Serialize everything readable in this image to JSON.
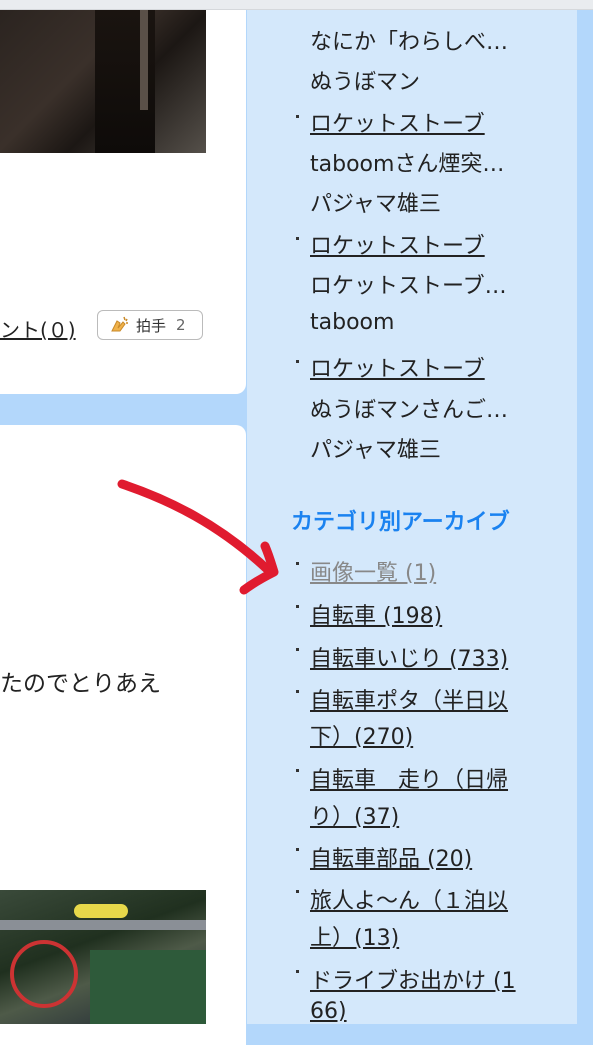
{
  "left": {
    "comment_link": "ント(０)",
    "clap_label": "拍手",
    "clap_count": "2",
    "body_text": "たのでとりあえ"
  },
  "sidebar": {
    "comments": [
      {
        "article": "",
        "text": "なにか「わらしべ…",
        "author": "ぬうぼマン"
      },
      {
        "article": "ロケットストーブ",
        "text": "taboomさん煙突…",
        "author": "パジャマ雄三"
      },
      {
        "article": "ロケットストーブ",
        "text": "ロケットストーブ…",
        "author": "taboom"
      },
      {
        "article": "ロケットストーブ",
        "text": "ぬうぼマンさんご…",
        "author": "パジャマ雄三"
      }
    ],
    "category_title": "カテゴリ別アーカイブ",
    "categories": [
      {
        "line1": "画像一覧 (1)",
        "line2": ""
      },
      {
        "line1": "自転車 (198)",
        "line2": ""
      },
      {
        "line1": "自転車いじり (733)",
        "line2": ""
      },
      {
        "line1": "自転車ポタ（半日以",
        "line2": "下）(270)"
      },
      {
        "line1": "自転車　走り（日帰",
        "line2": "り）(37)"
      },
      {
        "line1": "自転車部品 (20)",
        "line2": ""
      },
      {
        "line1": "旅人よ～ん（１泊以",
        "line2": "上）(13)"
      },
      {
        "line1": "ドライブお出かけ (1",
        "line2": "66)"
      }
    ]
  },
  "colors": {
    "page_bg": "#b3d7fb",
    "sidebar_bg": "#d4e8fb",
    "category_title": "#1a82f0",
    "arrow": "#e01b2f"
  }
}
